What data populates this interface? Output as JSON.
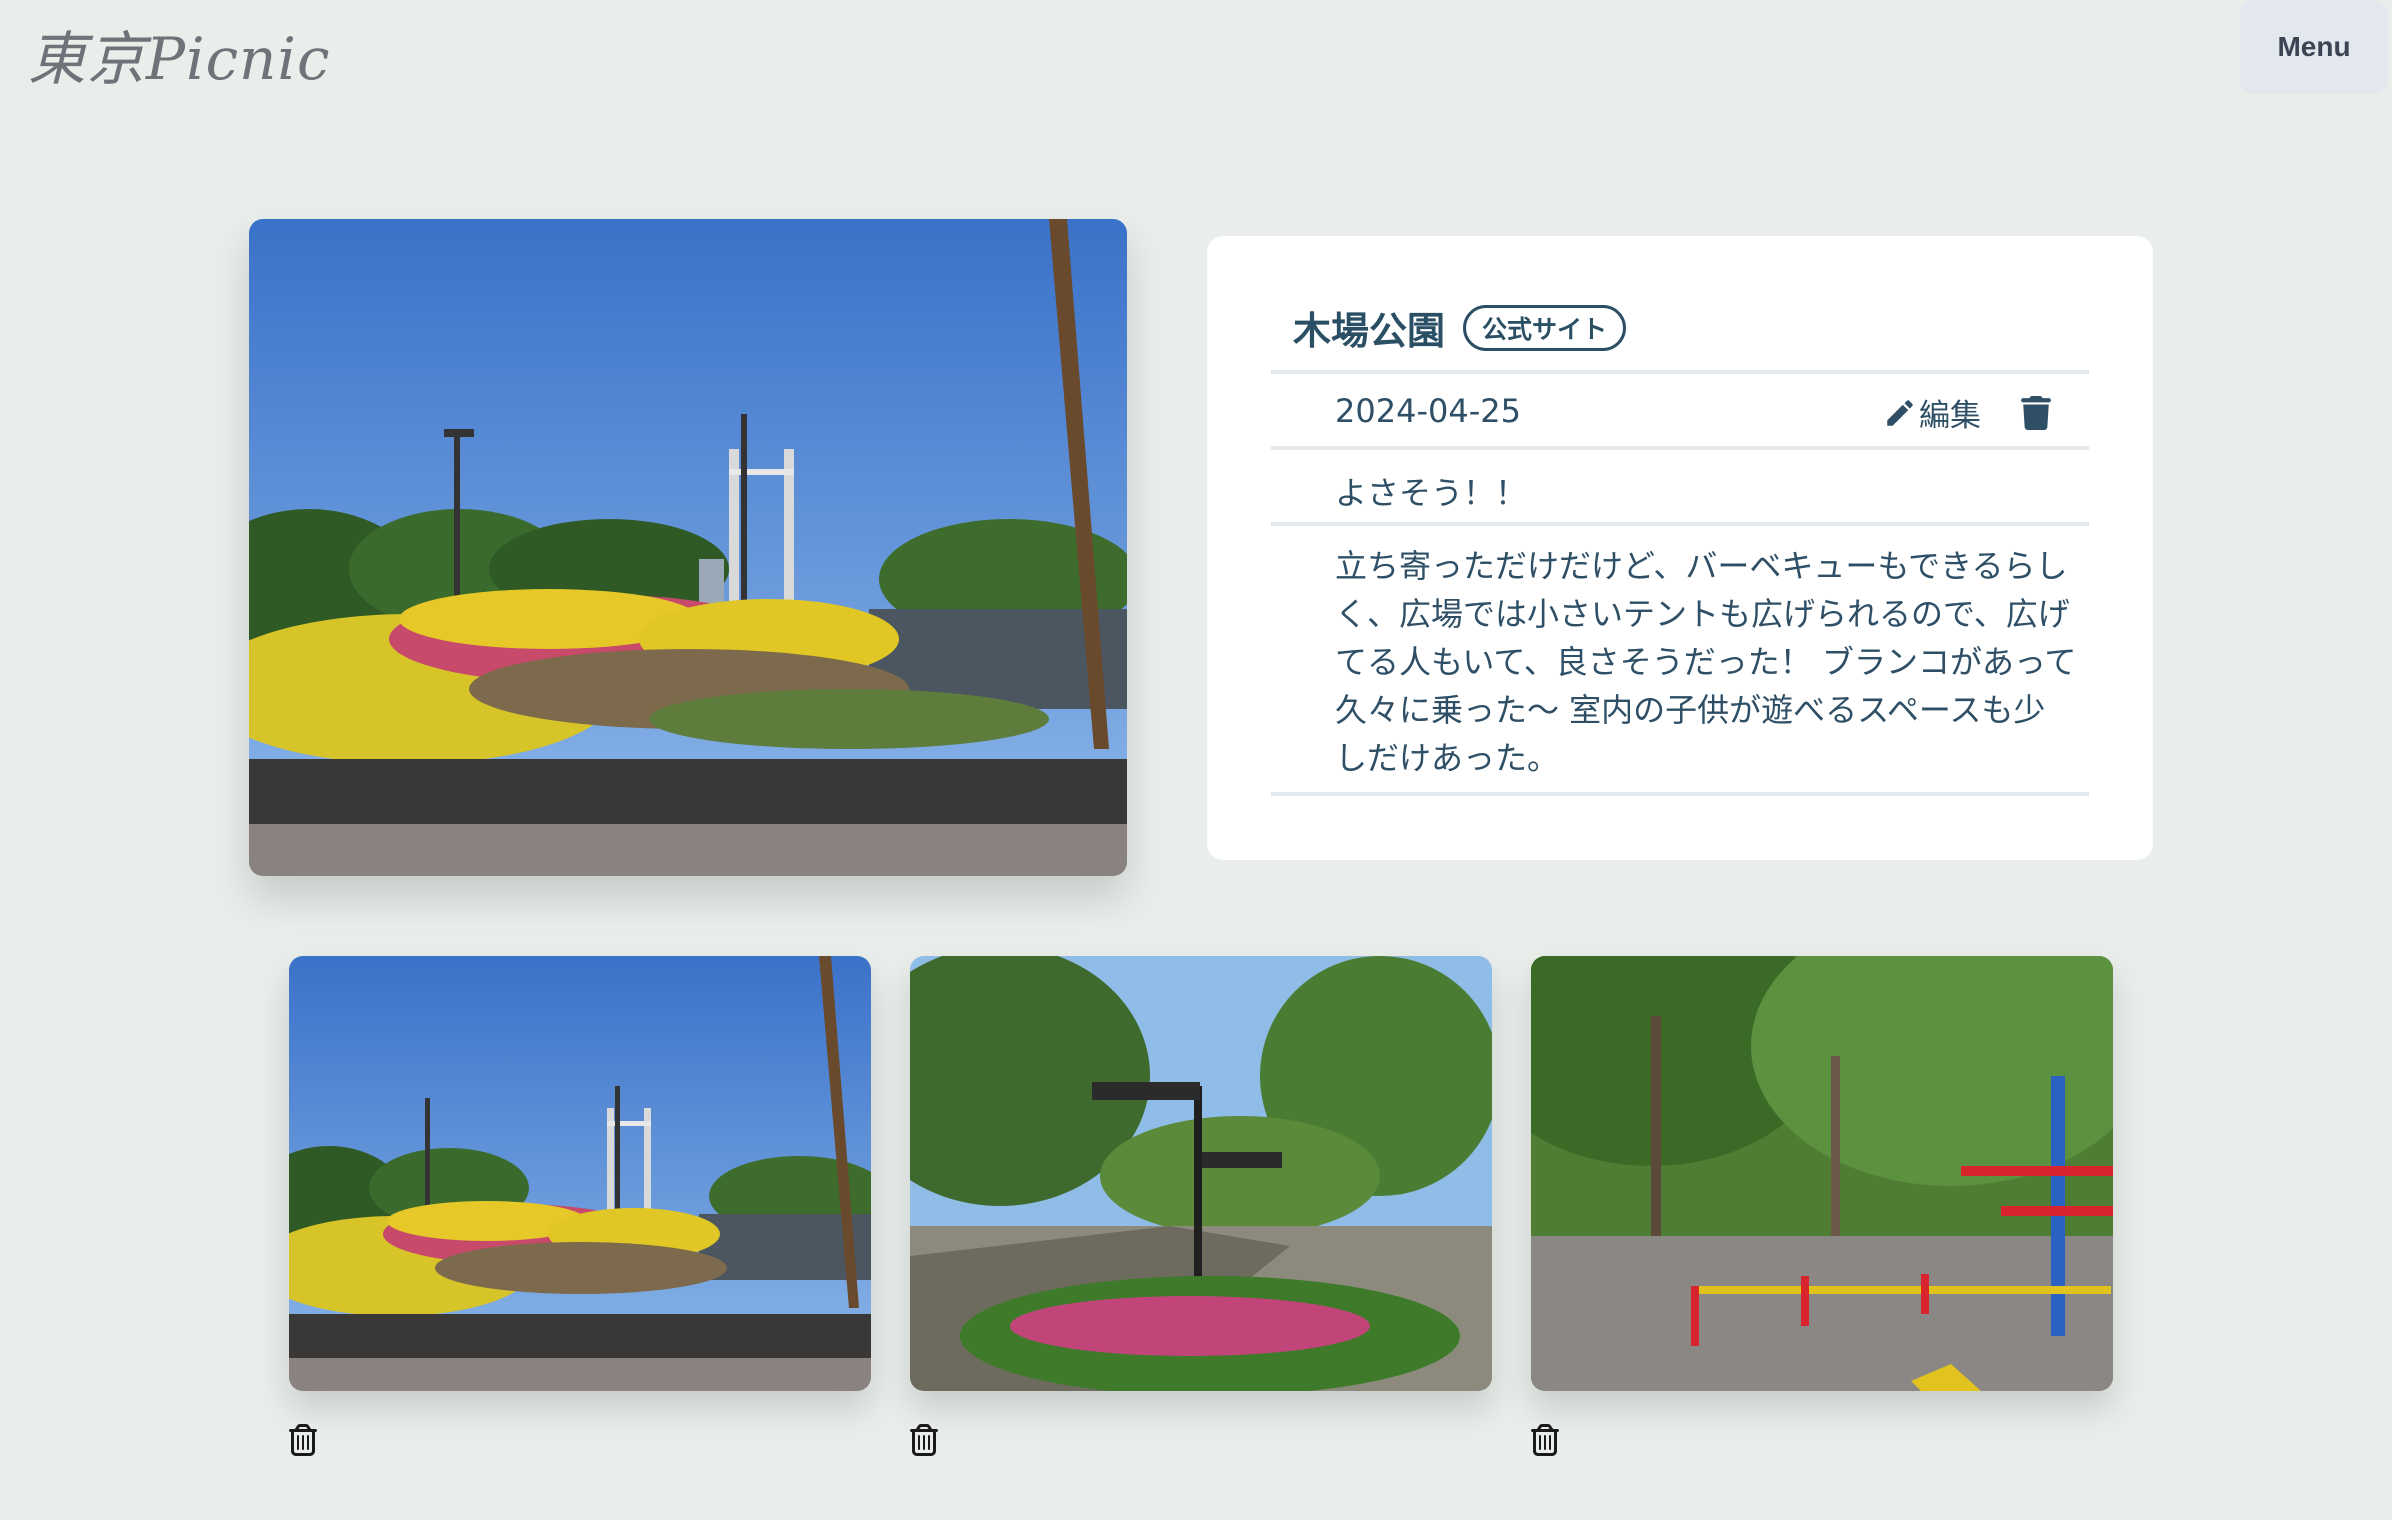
{
  "header": {
    "logo_text": "東京Picnic",
    "menu_label": "Menu"
  },
  "park": {
    "name": "木場公園",
    "official_site_label": "公式サイト",
    "date": "2024-04-25",
    "edit_label": "編集",
    "summary": "よさそう！！",
    "description": "立ち寄っただけだけど、バーベキューもできるらしく、広場では小さいテントも広げられるので、広げてる人もいて、良さそうだった！ ブランコがあって久々に乗った〜 室内の子供が遊べるスペースも少しだけあった。"
  },
  "colors": {
    "background": "#e9eeea",
    "text_primary": "#2e4f66",
    "card": "#ffffff",
    "menu_bg": "#e3e7ee"
  },
  "icons": {
    "edit": "pencil-icon",
    "delete": "trash-icon"
  }
}
